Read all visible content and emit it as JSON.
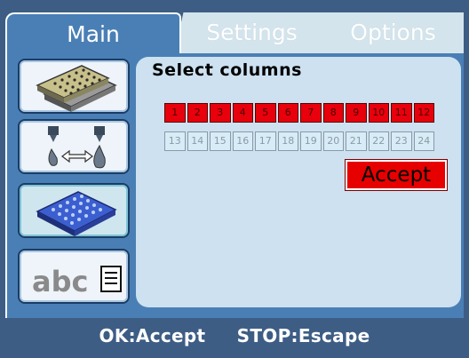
{
  "tabs": [
    {
      "label": "Main",
      "active": true
    },
    {
      "label": "Settings",
      "active": false
    },
    {
      "label": "Options",
      "active": false
    }
  ],
  "sidebar": {
    "items": [
      {
        "icon": "plates-icon",
        "selected": false
      },
      {
        "icon": "dispense-transfer-icon",
        "selected": false
      },
      {
        "icon": "plate-select-icon",
        "selected": true
      },
      {
        "icon": "abc-text-icon",
        "label": "abc",
        "selected": false
      }
    ]
  },
  "panel": {
    "title": "Select columns",
    "selected_columns": [
      "1",
      "2",
      "3",
      "4",
      "5",
      "6",
      "7",
      "8",
      "9",
      "10",
      "11",
      "12"
    ],
    "unselected_columns": [
      "13",
      "14",
      "15",
      "16",
      "17",
      "18",
      "19",
      "20",
      "21",
      "22",
      "23",
      "24"
    ],
    "accept_label": "Accept"
  },
  "status": {
    "ok": "OK:Accept",
    "stop": "STOP:Escape"
  },
  "colors": {
    "frame": "#3d5d85",
    "active_tab": "#4a7fb5",
    "panel": "#cde1f0",
    "selected_cell": "#e8000c",
    "accept": "#e60000"
  }
}
